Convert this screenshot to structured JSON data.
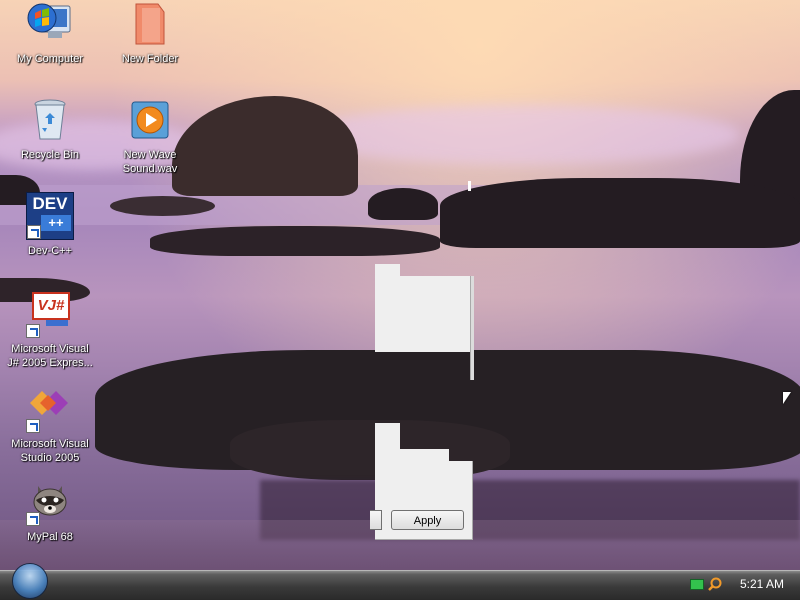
{
  "desktop": {
    "icons": [
      {
        "id": "my-computer",
        "label": "My Computer"
      },
      {
        "id": "new-folder",
        "label": "New Folder"
      },
      {
        "id": "recycle-bin",
        "label": "Recycle Bin"
      },
      {
        "id": "new-wave-sound",
        "label": "New Wave Sound.wav"
      },
      {
        "id": "dev-cpp",
        "label": "Dev-C++",
        "icon_text": "DEV",
        "icon_sub": "++"
      },
      {
        "id": "visual-jsharp",
        "label": "Microsoft Visual J# 2005 Expres...",
        "icon_text": "VJ#"
      },
      {
        "id": "visual-studio",
        "label": "Microsoft Visual Studio 2005"
      },
      {
        "id": "mypal",
        "label": "MyPal 68"
      }
    ]
  },
  "window": {
    "apply_label": "Apply"
  },
  "taskbar": {
    "clock": "5:21 AM"
  },
  "colors": {
    "taskbar": "#3a3a3a",
    "window_bg": "#efefef",
    "accent": "#1f5fc0"
  }
}
